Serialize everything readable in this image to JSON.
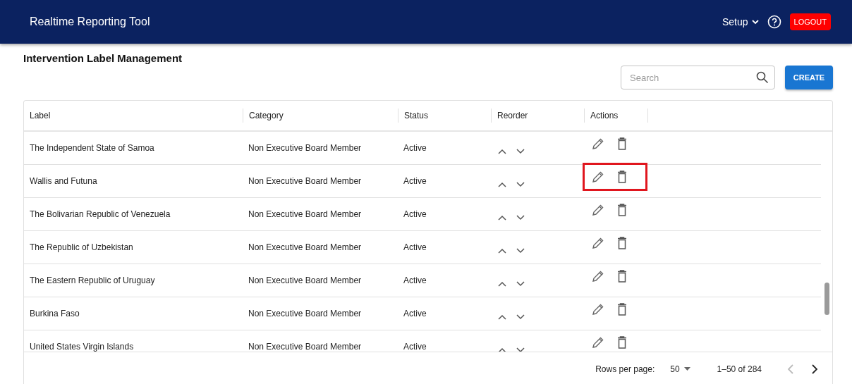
{
  "header": {
    "title": "Realtime Reporting Tool",
    "menu": "Setup",
    "logout": "LOGOUT"
  },
  "page_title": "Intervention Label Management",
  "search": {
    "placeholder": "Search"
  },
  "create_button": "CREATE",
  "table": {
    "columns": [
      "Label",
      "Category",
      "Status",
      "Reorder",
      "Actions"
    ],
    "rows": [
      {
        "label": "The Independent State of Samoa",
        "category": "Non Executive Board Member",
        "status": "Active",
        "highlighted": false
      },
      {
        "label": "Wallis and Futuna",
        "category": "Non Executive Board Member",
        "status": "Active",
        "highlighted": true
      },
      {
        "label": "The Bolivarian Republic of Venezuela",
        "category": "Non Executive Board Member",
        "status": "Active",
        "highlighted": false
      },
      {
        "label": "The Republic of Uzbekistan",
        "category": "Non Executive Board Member",
        "status": "Active",
        "highlighted": false
      },
      {
        "label": "The Eastern Republic of Uruguay",
        "category": "Non Executive Board Member",
        "status": "Active",
        "highlighted": false
      },
      {
        "label": "Burkina Faso",
        "category": "Non Executive Board Member",
        "status": "Active",
        "highlighted": false
      },
      {
        "label": "United States Virgin Islands",
        "category": "Non Executive Board Member",
        "status": "Active",
        "highlighted": false
      }
    ]
  },
  "pagination": {
    "rows_per_page_label": "Rows per page:",
    "rows_per_page": "50",
    "range": "1–50 of 284",
    "previous_disabled": true,
    "next_disabled": false
  }
}
